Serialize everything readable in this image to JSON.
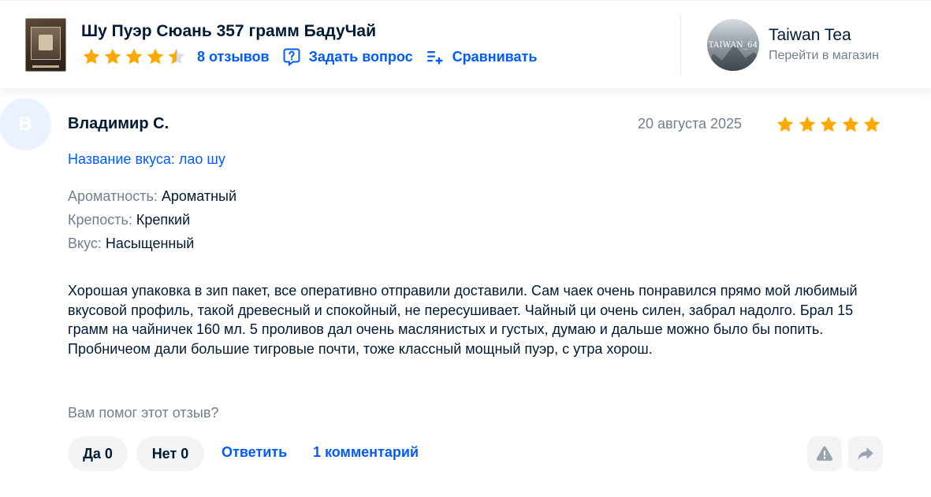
{
  "product": {
    "title": "Шу Пуэр Сюань 357 грамм БадуЧай",
    "rating": 4.5,
    "rating_max": 5,
    "reviews_link": "8 отзывов",
    "ask_link": "Задать вопрос",
    "compare_link": "Сравнивать",
    "thumbnail_icon": "tea-package-image"
  },
  "store": {
    "name": "Taiwan Tea",
    "link": "Перейти в магазин",
    "avatar_text": "TAIWAN_64"
  },
  "review": {
    "author_initial": "В",
    "author": "Владимир С.",
    "date": "20 августа 2025",
    "rating": 5,
    "variant": "Название вкуса: лао шу",
    "attributes": [
      {
        "key": "Ароматность:",
        "value": "Ароматный"
      },
      {
        "key": "Крепость:",
        "value": "Крепкий"
      },
      {
        "key": "Вкус:",
        "value": "Насыщенный"
      }
    ],
    "text": "Хорошая упаковка в зип пакет, все оперативно отправили доставили. Сам чаек очень понравился прямо мой любимый вкусовой профиль, такой древесный и спокойный, не пересушивает. Чайный ци очень силен, забрал надолго. Брал 15 грамм на чайничек 160 мл. 5 проливов дал очень маслянистых и густых, думаю и дальше можно было бы попить. Пробничеом дали большие тигровые почти, тоже классный мощный пуэр, с утра хорош."
  },
  "feedback": {
    "question": "Вам помог этот отзыв?",
    "yes_label": "Да 0",
    "no_label": "Нет 0",
    "reply_label": "Ответить",
    "comments_label": "1 комментарий"
  },
  "colors": {
    "accent": "#005bff",
    "star": "#ffa800",
    "text": "#001a34",
    "muted": "#707f8d",
    "pill_bg": "#f2f3f5",
    "icon_gray": "#99a3ae"
  }
}
